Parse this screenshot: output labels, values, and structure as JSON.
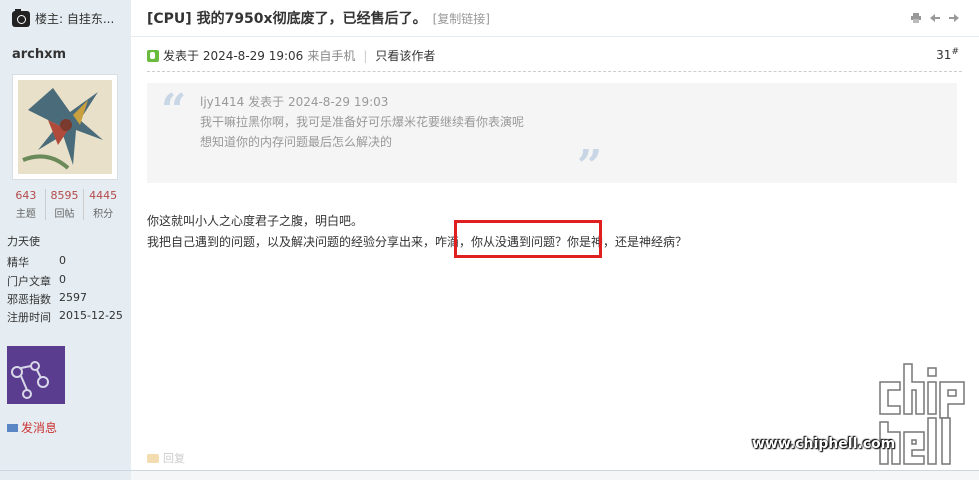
{
  "topbar": {
    "floor_owner": "楼主: 自挂东...",
    "thread_title": "[CPU] 我的7950x彻底废了，已经售后了。",
    "copy_link": "[复制链接]"
  },
  "author": {
    "name": "archxm",
    "stats": [
      {
        "num": "643",
        "label": "主题"
      },
      {
        "num": "8595",
        "label": "回帖"
      },
      {
        "num": "4445",
        "label": "积分"
      }
    ],
    "rank": "力天使",
    "info": [
      {
        "key": "精华",
        "value": "0"
      },
      {
        "key": "门户文章",
        "value": "0"
      },
      {
        "key": "邪恶指数",
        "value": "2597"
      },
      {
        "key": "注册时间",
        "value": "2015-12-25"
      }
    ],
    "send_message": "发消息"
  },
  "post": {
    "posted_at": "发表于 2024-8-29 19:06",
    "source": "来自手机",
    "separator": "|",
    "only_author": "只看该作者",
    "floor_num": "31",
    "floor_mark": "#",
    "quote": {
      "header": "ljy1414 发表于 2024-8-29 19:03",
      "lines": [
        "我干嘛拉黑你啊，我可是准备好可乐爆米花要继续看你表演呢",
        "想知道你的内存问题最后怎么解决的"
      ]
    },
    "body": [
      "你这就叫小人之心度君子之腹，明白吧。",
      "我把自己遇到的问题，以及解决问题的经验分享出来，咋滴，你从没遇到问题？你是神，还是神经病？"
    ],
    "reply": "回复"
  },
  "watermark": {
    "url": "www.chiphell.com"
  },
  "colors": {
    "sidebar_bg": "#e5edf2",
    "highlight": "#e02020",
    "stat_num": "#b54a4a"
  }
}
